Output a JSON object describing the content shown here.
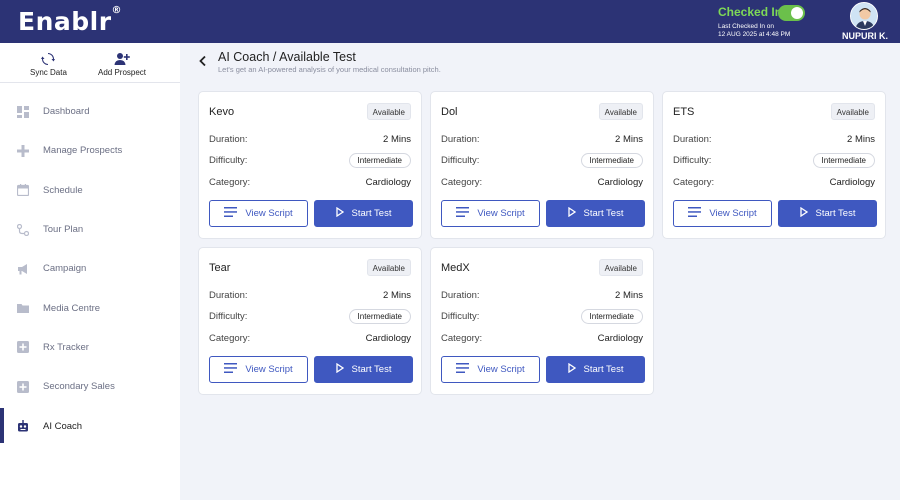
{
  "header": {
    "logo": "Enablr",
    "logo_mark": "®",
    "checkin_status": "Checked In",
    "last_checked_label": "Last Checked In on",
    "last_checked_time": "12 AUG 2025 at 4:48 PM",
    "user_name": "NUPURI K."
  },
  "sidebar": {
    "actions": [
      {
        "label": "Sync Data",
        "icon": "sync-icon"
      },
      {
        "label": "Add Prospect",
        "icon": "add-user-icon"
      }
    ],
    "items": [
      {
        "label": "Dashboard",
        "icon": "dashboard-icon"
      },
      {
        "label": "Manage Prospects",
        "icon": "plus-icon"
      },
      {
        "label": "Schedule",
        "icon": "calendar-icon"
      },
      {
        "label": "Tour Plan",
        "icon": "route-icon"
      },
      {
        "label": "Campaign",
        "icon": "megaphone-icon"
      },
      {
        "label": "Media Centre",
        "icon": "folder-icon"
      },
      {
        "label": "Rx Tracker",
        "icon": "plus-box-icon"
      },
      {
        "label": "Secondary Sales",
        "icon": "plus-box-icon"
      },
      {
        "label": "AI Coach",
        "icon": "robot-icon",
        "active": true
      }
    ]
  },
  "main": {
    "title": "AI Coach / Available Test",
    "subtitle": "Let's get an AI-powered analysis of your medical consultation pitch.",
    "labels": {
      "duration": "Duration:",
      "difficulty": "Difficulty:",
      "category": "Category:",
      "view_script": "View Script",
      "start_test": "Start Test"
    },
    "cards": [
      {
        "name": "Kevo",
        "status": "Available",
        "duration": "2 Mins",
        "difficulty": "Intermediate",
        "category": "Cardiology"
      },
      {
        "name": "Dol",
        "status": "Available",
        "duration": "2 Mins",
        "difficulty": "Intermediate",
        "category": "Cardiology"
      },
      {
        "name": "ETS",
        "status": "Available",
        "duration": "2 Mins",
        "difficulty": "Intermediate",
        "category": "Cardiology"
      },
      {
        "name": "Tear",
        "status": "Available",
        "duration": "2 Mins",
        "difficulty": "Intermediate",
        "category": "Cardiology"
      },
      {
        "name": "MedX",
        "status": "Available",
        "duration": "2 Mins",
        "difficulty": "Intermediate",
        "category": "Cardiology"
      }
    ]
  },
  "colors": {
    "header_bg": "#2c3375",
    "accent": "#3f58c0",
    "checkin_green": "#7ed957"
  }
}
